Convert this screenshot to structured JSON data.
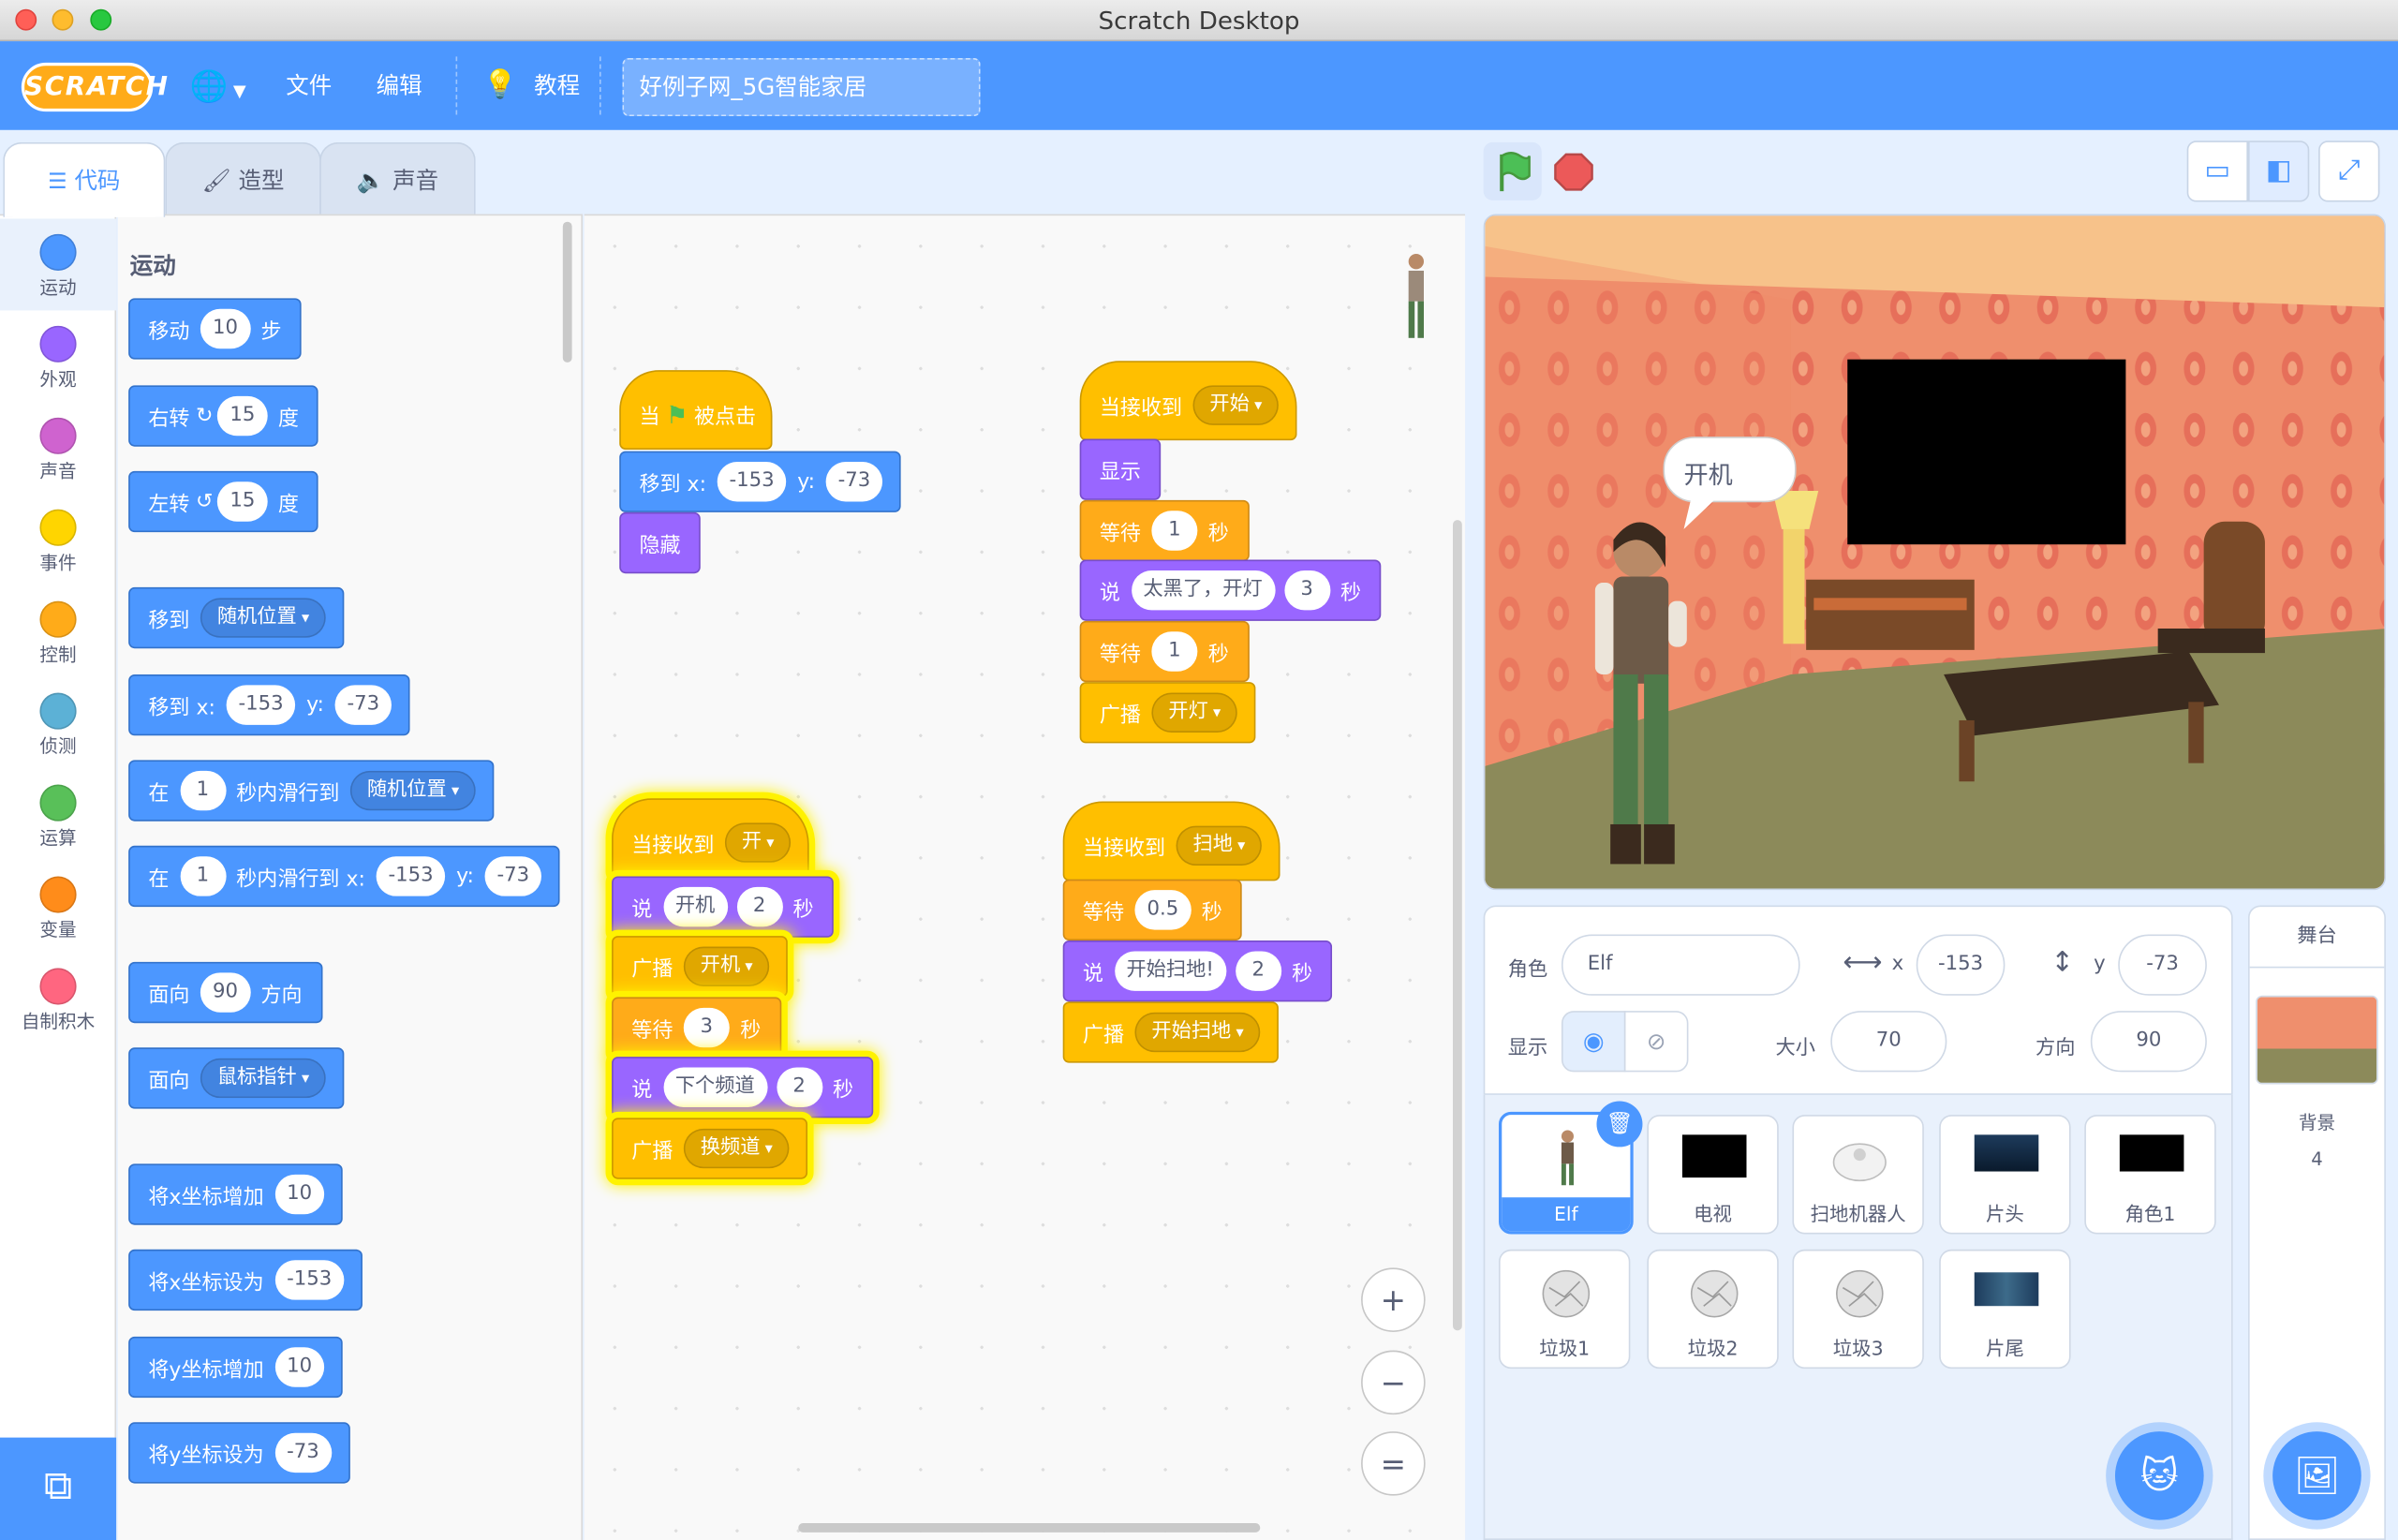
{
  "window_title": "Scratch Desktop",
  "menu": {
    "logo": "SCRATCH",
    "file": "文件",
    "edit": "编辑",
    "tutorials": "教程",
    "project_title": "好例子网_5G智能家居"
  },
  "tabs": {
    "code": "代码",
    "costumes": "造型",
    "sounds": "声音"
  },
  "categories": [
    {
      "label": "运动",
      "color": "#4c97ff"
    },
    {
      "label": "外观",
      "color": "#9966ff"
    },
    {
      "label": "声音",
      "color": "#cf63cf"
    },
    {
      "label": "事件",
      "color": "#ffd500"
    },
    {
      "label": "控制",
      "color": "#ffab19"
    },
    {
      "label": "侦测",
      "color": "#5cb1d6"
    },
    {
      "label": "运算",
      "color": "#59c059"
    },
    {
      "label": "变量",
      "color": "#ff8c1a"
    },
    {
      "label": "自制积木",
      "color": "#ff6680"
    }
  ],
  "palette": {
    "title": "运动",
    "move": {
      "a": "移动",
      "n": "10",
      "b": "步"
    },
    "turn_right": {
      "a": "右转",
      "n": "15",
      "b": "度"
    },
    "turn_left": {
      "a": "左转",
      "n": "15",
      "b": "度"
    },
    "goto": {
      "a": "移到",
      "d": "随机位置"
    },
    "goto_xy": {
      "a": "移到 x:",
      "x": "-153",
      "yl": "y:",
      "y": "-73"
    },
    "glide": {
      "a": "在",
      "n": "1",
      "b": "秒内滑行到",
      "d": "随机位置"
    },
    "glide_xy": {
      "a": "在",
      "n": "1",
      "b": "秒内滑行到 x:",
      "x": "-153",
      "yl": "y:",
      "y": "-73"
    },
    "point": {
      "a": "面向",
      "n": "90",
      "b": "方向"
    },
    "point_towards": {
      "a": "面向",
      "d": "鼠标指针"
    },
    "change_x": {
      "a": "将x坐标增加",
      "n": "10"
    },
    "set_x": {
      "a": "将x坐标设为",
      "n": "-153"
    },
    "change_y": {
      "a": "将y坐标增加",
      "n": "10"
    },
    "set_y": {
      "a": "将y坐标设为",
      "n": "-73"
    }
  },
  "scripts": {
    "s1": {
      "hat_a": "当",
      "hat_b": "被点击",
      "goto": "移到 x:",
      "x": "-153",
      "yl": "y:",
      "y": "-73",
      "hide": "隐藏"
    },
    "s2": {
      "hat": "当接收到",
      "hat_d": "开始",
      "show": "显示",
      "wait": "等待",
      "w1": "1",
      "sec": "秒",
      "say": "说",
      "say_text": "太黑了，开灯",
      "say_n": "3",
      "w2": "1",
      "broadcast": "广播",
      "bc_d": "开灯"
    },
    "s3": {
      "hat": "当接收到",
      "hat_d": "开",
      "say": "说",
      "say1": "开机",
      "n1": "2",
      "sec": "秒",
      "broadcast": "广播",
      "bc1": "开机",
      "wait": "等待",
      "w": "3",
      "say2": "下个频道",
      "n2": "2",
      "bc2": "换频道"
    },
    "s4": {
      "hat": "当接收到",
      "hat_d": "扫地",
      "wait": "等待",
      "w": "0.5",
      "sec": "秒",
      "say": "说",
      "say_text": "开始扫地!",
      "n": "2",
      "broadcast": "广播",
      "bc": "开始扫地"
    }
  },
  "zoom": {
    "in": "+",
    "out": "−",
    "reset": "="
  },
  "stage": {
    "bubble": "开机"
  },
  "sprite_info": {
    "sprite_label": "角色",
    "sprite_name": "Elf",
    "x_label": "x",
    "x": "-153",
    "y_label": "y",
    "y": "-73",
    "show_label": "显示",
    "size_label": "大小",
    "size": "70",
    "direction_label": "方向",
    "direction": "90"
  },
  "sprites": [
    "Elf",
    "电视",
    "扫地机器人",
    "片头",
    "角色1",
    "垃圾1",
    "垃圾2",
    "垃圾3",
    "片尾"
  ],
  "stage_panel": {
    "title": "舞台",
    "backdrops_label": "背景",
    "backdrops_count": "4"
  }
}
